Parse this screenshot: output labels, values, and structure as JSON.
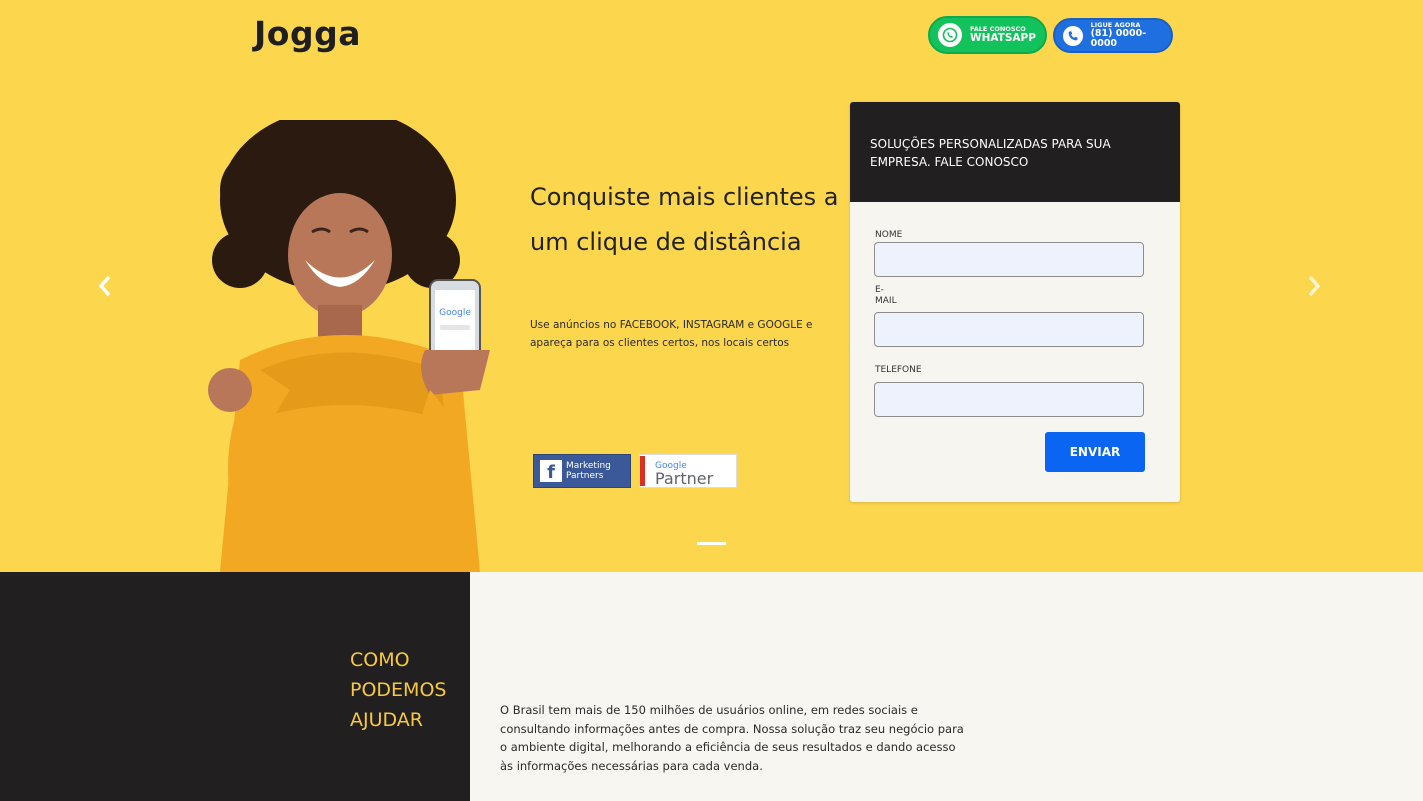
{
  "header": {
    "logo_text": "Jogga",
    "whatsapp": {
      "small": "FALE CONOSCO",
      "big": "WHATSAPP",
      "color": "#12c25b",
      "icon": "whatsapp-icon"
    },
    "phone": {
      "small": "LIGUE AGORA",
      "big": "(81) 0000-0000",
      "color": "#1f6fe0",
      "icon": "phone-icon"
    }
  },
  "carousel": {
    "prev_icon": "chevron-left-icon",
    "next_icon": "chevron-right-icon",
    "slide": {
      "headline": "Conquiste mais clientes a um clique de distância",
      "subtext": "Use anúncios no FACEBOOK, INSTAGRAM e GOOGLE e apareça para os clientes certos, nos locais certos",
      "badges": {
        "facebook": {
          "line1": "Marketing",
          "line2": "Partners"
        },
        "google": {
          "line1": "Google",
          "line2": "Partner"
        }
      },
      "phone_screen_text": "Google"
    }
  },
  "form": {
    "title": "SOLUÇÕES PERSONALIZADAS PARA SUA EMPRESA. FALE CONOSCO",
    "fields": [
      {
        "label": "NOME",
        "value": ""
      },
      {
        "label": "E-\nMAIL",
        "value": ""
      },
      {
        "label": "TELEFONE",
        "value": ""
      }
    ],
    "submit_label": "ENVIAR"
  },
  "section": {
    "heading": "COMO PODEMOS AJUDAR",
    "body": "O Brasil tem mais de 150 milhões de usuários online, em redes sociais e consultando informações antes de compra. Nossa solução traz seu negócio para o ambiente digital, melhorando a eficiência de seus resultados e dando acesso às informações necessárias para cada venda."
  },
  "colors": {
    "hero_bg": "#fcd64d",
    "dark": "#221f20",
    "accent_text": "#f6c940",
    "button": "#0a66f2"
  }
}
